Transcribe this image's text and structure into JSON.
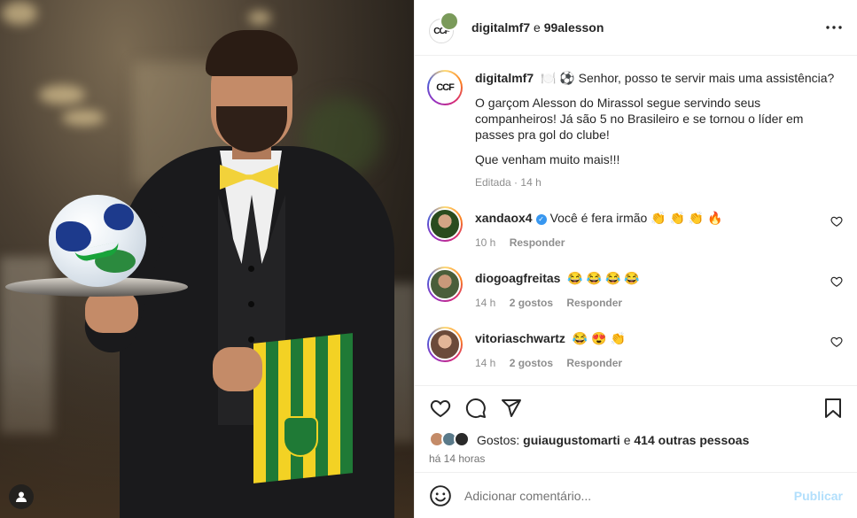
{
  "post": {
    "header": {
      "author": "digitalmf7",
      "connector": "e",
      "coauthor": "99alesson",
      "avatar_text": "CCF"
    },
    "caption": {
      "username": "digitalmf7",
      "line1": "🍽️ ⚽ Senhor, posso te servir mais uma assistência?",
      "paragraph2": "O garçom Alesson do Mirassol segue servindo seus companheiros! Já são 5 no Brasileiro e se tornou o líder em passes pra gol do clube!",
      "paragraph3": "Que venham muito mais!!!",
      "edited": "Editada",
      "dot": "·",
      "time": "14 h"
    },
    "comments": [
      {
        "username": "xandaox4",
        "verified": true,
        "text": "Você é fera irmão 👏 👏 👏 🔥",
        "time": "10 h",
        "likes": "",
        "reply": "Responder"
      },
      {
        "username": "diogoagfreitas",
        "verified": false,
        "text": "😂 😂 😂 😂",
        "time": "14 h",
        "likes": "2 gostos",
        "reply": "Responder"
      },
      {
        "username": "vitoriaschwartz",
        "verified": false,
        "text": "😂 😍 👏",
        "time": "14 h",
        "likes": "2 gostos",
        "reply": "Responder"
      }
    ],
    "likes": {
      "prefix": "Gostos:",
      "first_liker": "guiaugustomarti",
      "connector": "e",
      "others": "414 outras pessoas"
    },
    "timestamp": "há 14 horas",
    "add_comment": {
      "placeholder": "Adicionar comentário...",
      "publish": "Publicar"
    }
  },
  "colors": {
    "accent": "#0095f6",
    "publish_disabled": "#b2dffc",
    "muted": "#8e8e8e",
    "towel_yellow": "#f3d224",
    "towel_green": "#1f7a36",
    "bowtie": "#f2d23a"
  },
  "icons": [
    "user-tag-icon",
    "more-options-icon",
    "like-heart-icon",
    "comment-icon",
    "share-icon",
    "save-bookmark-icon",
    "emoji-icon",
    "comment-heart-icon",
    "verified-badge-icon"
  ]
}
